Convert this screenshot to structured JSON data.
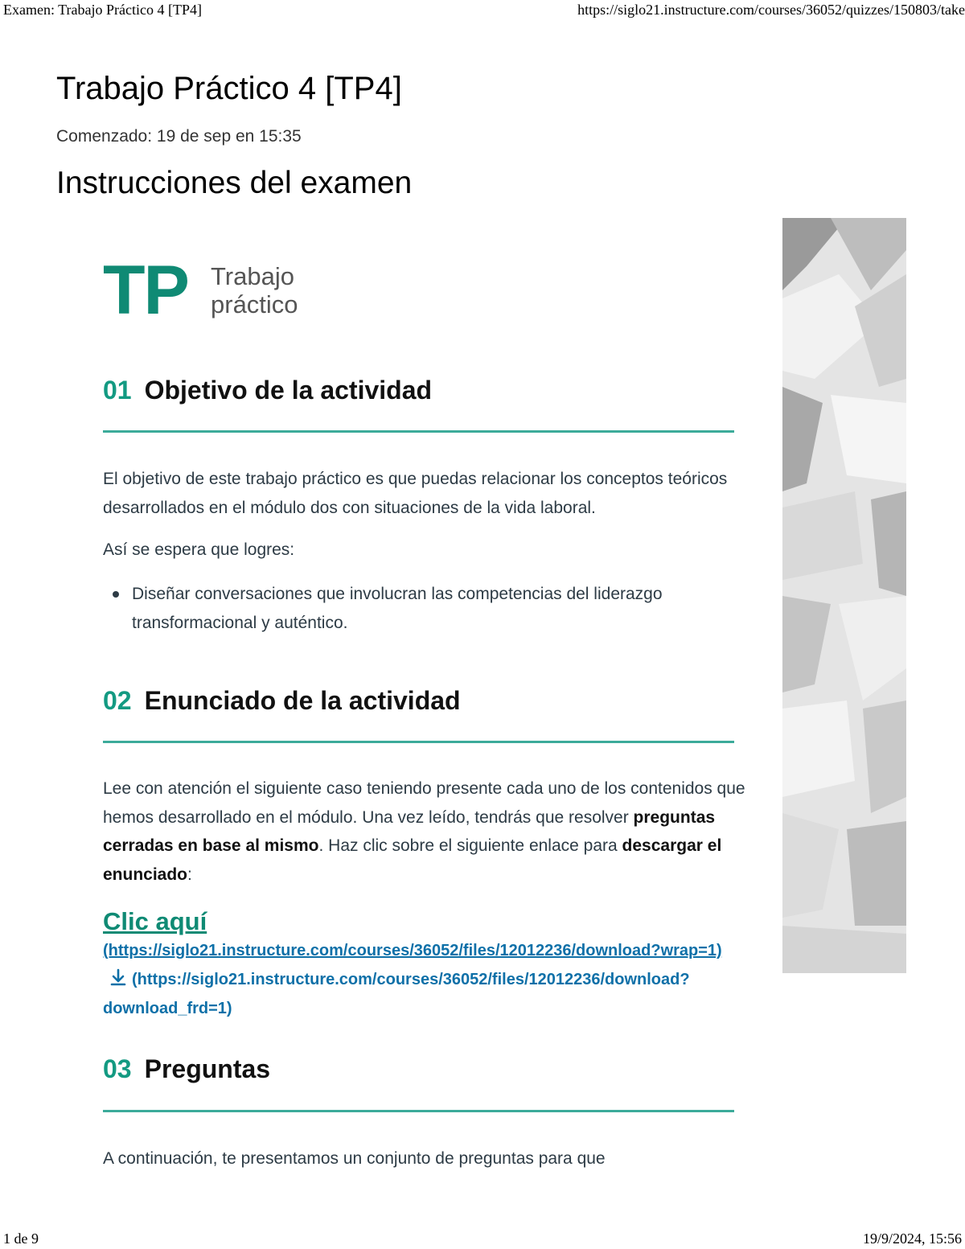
{
  "print_header": {
    "left": "Examen: Trabajo Práctico 4 [TP4]",
    "right": "https://siglo21.instructure.com/courses/36052/quizzes/150803/take"
  },
  "print_footer": {
    "left": "1 de 9",
    "right": "19/9/2024, 15:56"
  },
  "page": {
    "title": "Trabajo Práctico 4 [TP4]",
    "started": "Comenzado: 19 de sep en 15:35",
    "instructions_title": "Instrucciones del examen"
  },
  "logo": {
    "letters": "TP",
    "word1": "Trabajo",
    "word2": "práctico",
    "color": "#0f8a74"
  },
  "sections": [
    {
      "number": "01",
      "title": "Objetivo de la actividad",
      "paragraph1": "El objetivo de este trabajo práctico es que puedas relacionar los conceptos teóricos desarrollados en el módulo dos con situaciones de la vida laboral.",
      "paragraph2": "Así se espera que logres:",
      "bullet": "Diseñar conversaciones que involucran las competencias del liderazgo transformacional y auténtico."
    },
    {
      "number": "02",
      "title": "Enunciado de la actividad",
      "text_a": "Lee con atención el siguiente caso teniendo presente cada uno de los contenidos que hemos desarrollado en el módulo. Una vez leído, tendrás que resolver ",
      "bold_a": "preguntas cerradas en base al mismo",
      "text_b": ". Haz clic sobre el siguiente enlace para ",
      "bold_b": "descargar el enunciado",
      "text_c": ":",
      "link_label": "Clic aquí",
      "link_url": "(https://siglo21.instructure.com/courses/36052/files/12012236/download?wrap=1)",
      "download_url": "(https://siglo21.instructure.com/courses/36052/files/12012236/download?download_frd=1)"
    },
    {
      "number": "03",
      "title": "Preguntas",
      "paragraph1": "A continuación, te presentamos un conjunto de preguntas para que"
    }
  ],
  "colors": {
    "accent": "#139a82",
    "rule": "#3cab9a",
    "link": "#0e70a8"
  },
  "icons": [
    "download-icon"
  ]
}
